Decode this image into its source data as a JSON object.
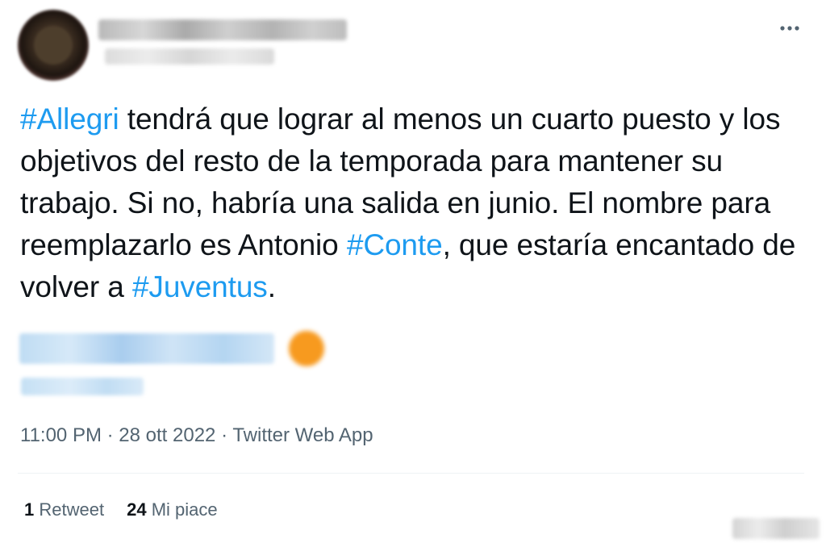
{
  "tweet": {
    "author": {
      "avatar_icon": "avatar-image"
    },
    "text_segments": [
      {
        "text": "#Allegri",
        "hashtag": true
      },
      {
        "text": " tendrá que lograr al menos un cuarto puesto y los objetivos del resto de la temporada para mantener su trabajo. Si no, habría una salida en junio. El nombre para reemplazarlo es Antonio ",
        "hashtag": false
      },
      {
        "text": "#Conte",
        "hashtag": true
      },
      {
        "text": ", que estaría encantado de volver a ",
        "hashtag": false
      },
      {
        "text": "#Juventus",
        "hashtag": true
      },
      {
        "text": ".",
        "hashtag": false
      }
    ],
    "more_icon": "ellipsis-icon",
    "meta": {
      "time": "11:00 PM",
      "separator": "·",
      "date": "28 ott 2022",
      "source": "Twitter Web App"
    },
    "stats": {
      "retweets_count": "1",
      "retweets_label": "Retweet",
      "likes_count": "24",
      "likes_label": "Mi piace"
    }
  },
  "colors": {
    "text": "#0f1419",
    "hashtag": "#1d9bf0",
    "secondary": "#536471",
    "divider": "#eff3f4",
    "embedded_emoji": "#f79a1f"
  }
}
